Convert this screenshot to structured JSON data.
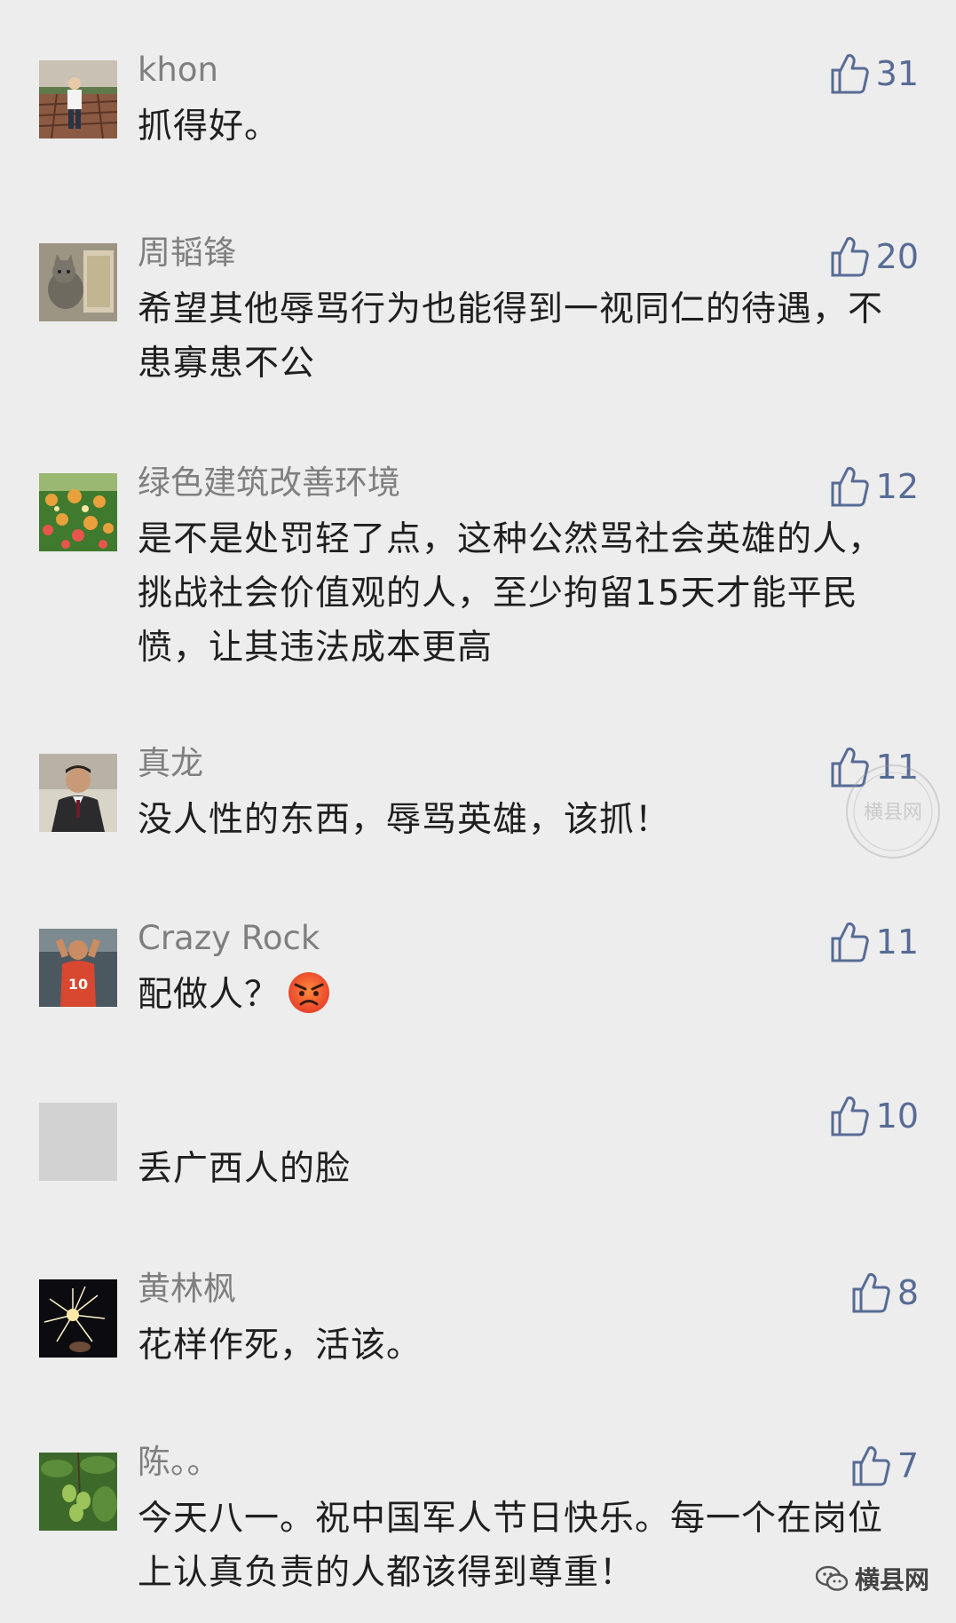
{
  "comments": [
    {
      "name": "khon",
      "text": "抓得好。",
      "likes": "31",
      "avatar": "construction-site-photo"
    },
    {
      "name": "周韬锋",
      "text": "希望其他辱骂行为也能得到一视同仁的待遇，不患寡患不公",
      "likes": "20",
      "avatar": "cat-in-box-photo"
    },
    {
      "name": "绿色建筑改善环境",
      "text": "是不是处罚轻了点，这种公然骂社会英雄的人，挑战社会价值观的人，至少拘留15天才能平民愤，让其违法成本更高",
      "likes": "12",
      "avatar": "flowers-photo"
    },
    {
      "name": "真龙",
      "text": "没人性的东西，辱骂英雄，该抓！",
      "likes": "11",
      "avatar": "man-in-suit-photo"
    },
    {
      "name": "Crazy Rock",
      "text": "配做人？",
      "likes": "11",
      "avatar": "basketball-player-photo",
      "emoji": "angry-face-emoji"
    },
    {
      "name": "",
      "text": "丢广西人的脸",
      "likes": "10",
      "avatar": "blank-gray"
    },
    {
      "name": "黄林枫",
      "text": "花样作死，活该。",
      "likes": "8",
      "avatar": "sparkler-photo"
    },
    {
      "name": "陈。。",
      "text": "今天八一。祝中国军人节日快乐。每一个在岗位上认真负责的人都该得到尊重！",
      "likes": "7",
      "avatar": "mango-tree-photo"
    }
  ],
  "watermark": {
    "seal_text": "横县网",
    "footer_text": "横县网",
    "icon": "wechat-icon"
  },
  "colors": {
    "background": "#ededed",
    "username": "#7f7f7f",
    "text": "#1f1f1f",
    "like": "#576b95"
  }
}
